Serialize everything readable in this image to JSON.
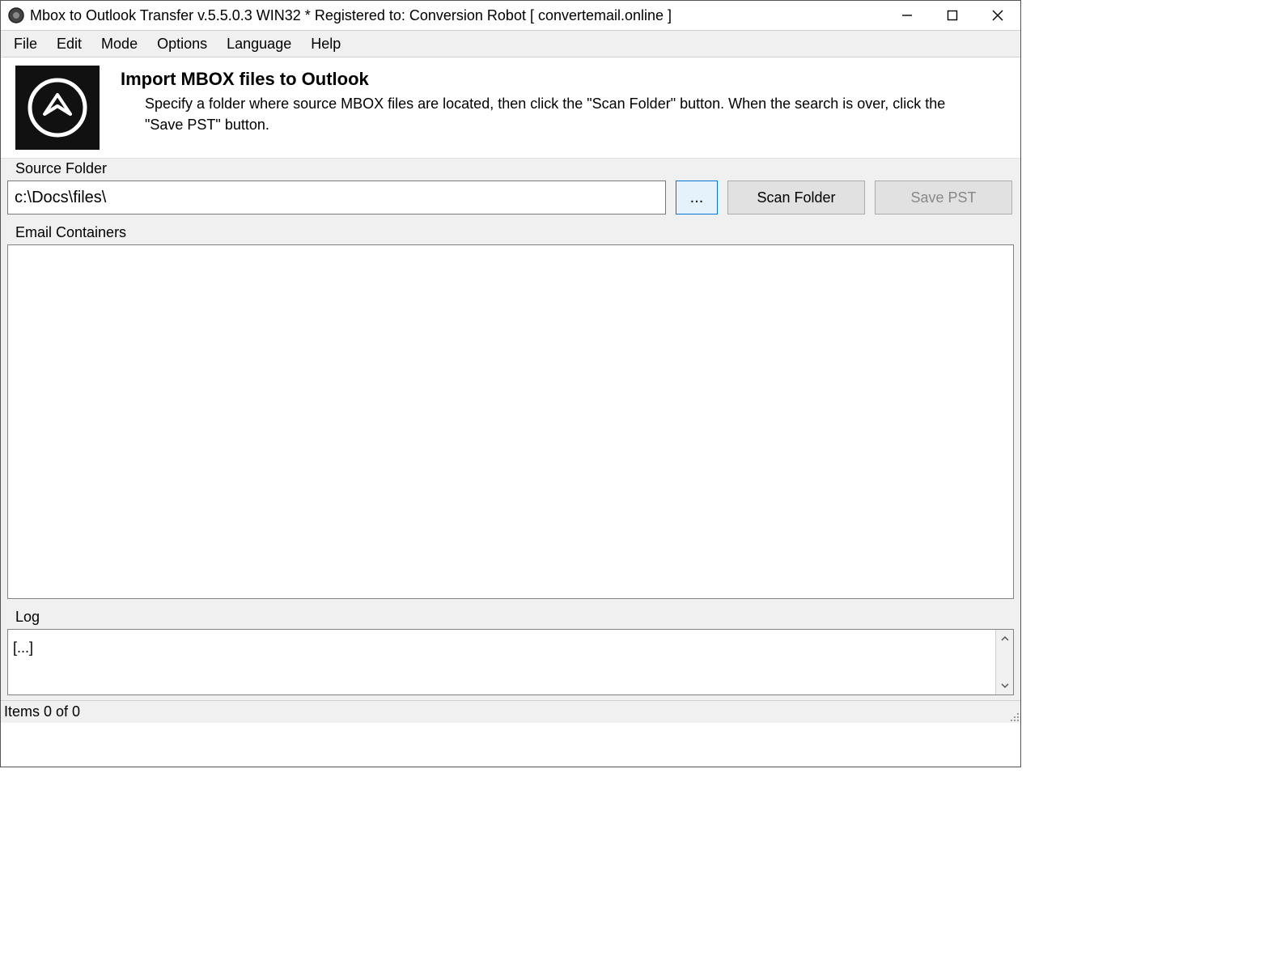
{
  "window": {
    "title": "Mbox to Outlook Transfer v.5.5.0.3 WIN32 * Registered to: Conversion Robot [ convertemail.online ]"
  },
  "menu": {
    "items": [
      "File",
      "Edit",
      "Mode",
      "Options",
      "Language",
      "Help"
    ]
  },
  "banner": {
    "heading": "Import MBOX files to Outlook",
    "description": "Specify a folder where source MBOX files are located, then click the \"Scan Folder\" button. When the search is over, click the \"Save PST\" button."
  },
  "source": {
    "group_label": "Source Folder",
    "path_value": "c:\\Docs\\files\\",
    "browse_label": "...",
    "scan_label": "Scan Folder",
    "save_label": "Save PST"
  },
  "containers": {
    "group_label": "Email Containers"
  },
  "log": {
    "group_label": "Log",
    "content": "[...]"
  },
  "status": {
    "text": "Items 0 of 0"
  }
}
